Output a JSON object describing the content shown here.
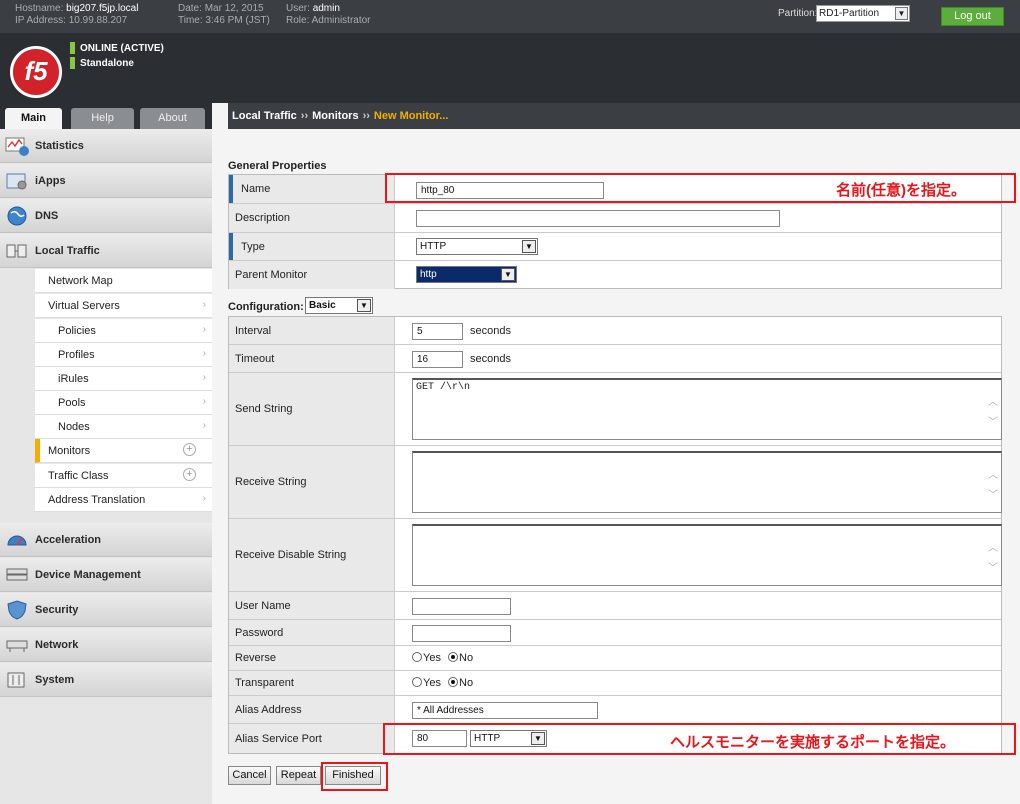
{
  "header": {
    "hostname_label": "Hostname:",
    "hostname": "big207.f5jp.local",
    "ip_label": "IP Address:",
    "ip": "10.99.88.207",
    "date_label": "Date:",
    "date": "Mar 12, 2015",
    "time_label": "Time:",
    "time": "3:46 PM (JST)",
    "user_label": "User:",
    "user": "admin",
    "role_label": "Role:",
    "role": "Administrator",
    "partition_label": "Partition:",
    "partition_value": "RD1-Partition",
    "logout_label": "Log out"
  },
  "banner": {
    "logo_text": "f5",
    "status_line1": "ONLINE (ACTIVE)",
    "status_line2": "Standalone"
  },
  "tabs": [
    {
      "label": "Main",
      "active": true
    },
    {
      "label": "Help",
      "active": false
    },
    {
      "label": "About",
      "active": false
    }
  ],
  "sidebar": {
    "sections": [
      {
        "label": "Statistics",
        "icon": "statistics-icon"
      },
      {
        "label": "iApps",
        "icon": "iapps-icon"
      },
      {
        "label": "DNS",
        "icon": "dns-icon"
      },
      {
        "label": "Local Traffic",
        "icon": "local-traffic-icon"
      },
      {
        "label": "Acceleration",
        "icon": "acceleration-icon"
      },
      {
        "label": "Device Management",
        "icon": "device-management-icon"
      },
      {
        "label": "Security",
        "icon": "security-icon"
      },
      {
        "label": "Network",
        "icon": "network-icon"
      },
      {
        "label": "System",
        "icon": "system-icon"
      }
    ],
    "local_traffic_items": [
      {
        "label": "Network Map"
      },
      {
        "label": "Virtual Servers"
      },
      {
        "label": "Policies"
      },
      {
        "label": "Profiles"
      },
      {
        "label": "iRules"
      },
      {
        "label": "Pools"
      },
      {
        "label": "Nodes"
      },
      {
        "label": "Monitors"
      },
      {
        "label": "Traffic Class"
      },
      {
        "label": "Address Translation"
      }
    ]
  },
  "breadcrumb": {
    "part1": "Local Traffic",
    "part2": "Monitors",
    "current": "New Monitor...",
    "separator": "››"
  },
  "general": {
    "heading": "General Properties",
    "name_label": "Name",
    "name_value": "http_80",
    "description_label": "Description",
    "description_value": "",
    "type_label": "Type",
    "type_value": "HTTP",
    "parent_label": "Parent Monitor",
    "parent_value": "http"
  },
  "configuration": {
    "heading": "Configuration:",
    "mode_value": "Basic",
    "interval_label": "Interval",
    "interval_value": "5",
    "timeout_label": "Timeout",
    "timeout_value": "16",
    "seconds_label": "seconds",
    "send_label": "Send String",
    "send_value": "GET /\\r\\n",
    "receive_label": "Receive String",
    "receive_value": "",
    "receive_disable_label": "Receive Disable String",
    "receive_disable_value": "",
    "username_label": "User Name",
    "username_value": "",
    "password_label": "Password",
    "password_value": "",
    "reverse_label": "Reverse",
    "transparent_label": "Transparent",
    "yes_label": "Yes",
    "no_label": "No",
    "alias_address_label": "Alias Address",
    "alias_address_value": "* All Addresses",
    "alias_port_label": "Alias Service Port",
    "alias_port_value": "80",
    "alias_port_service": "HTTP"
  },
  "buttons": {
    "cancel": "Cancel",
    "repeat": "Repeat",
    "finished": "Finished"
  },
  "annotations": {
    "name_note": "名前(任意)を指定。",
    "port_note": "ヘルスモニターを実施するポートを指定。",
    "color": "#e8161b"
  }
}
